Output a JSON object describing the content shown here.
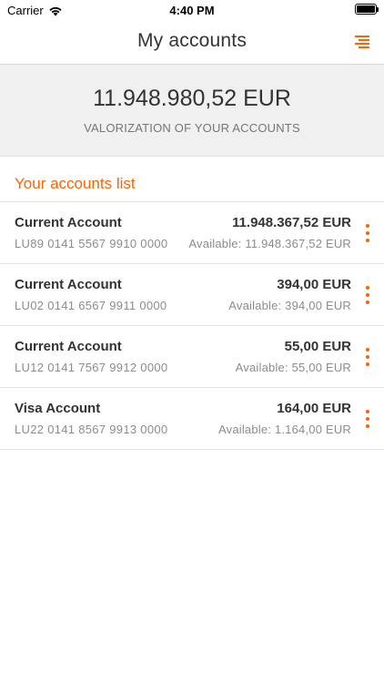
{
  "status_bar": {
    "carrier": "Carrier",
    "time": "4:40 PM"
  },
  "nav": {
    "title": "My accounts",
    "menu_icon": "menu-icon"
  },
  "summary": {
    "amount": "11.948.980,52 EUR",
    "label": "VALORIZATION OF YOUR ACCOUNTS"
  },
  "list": {
    "header": "Your accounts list",
    "accounts": [
      {
        "name": "Current Account",
        "iban": "LU89 0141 5567 9910 0000",
        "amount": "11.948.367,52  EUR",
        "available": "Available: 11.948.367,52  EUR"
      },
      {
        "name": "Current Account",
        "iban": "LU02 0141 6567 9911 0000",
        "amount": "394,00  EUR",
        "available": "Available: 394,00  EUR"
      },
      {
        "name": "Current Account",
        "iban": "LU12 0141 7567 9912 0000",
        "amount": "55,00  EUR",
        "available": "Available: 55,00  EUR"
      },
      {
        "name": "Visa Account",
        "iban": "LU22 0141 8567 9913 0000",
        "amount": "164,00  EUR",
        "available": "Available: 1.164,00  EUR"
      }
    ]
  },
  "colors": {
    "accent": "#ff6200",
    "text": "#333333",
    "muted": "#8c8c8c",
    "summary_bg": "#f0f0f0"
  }
}
